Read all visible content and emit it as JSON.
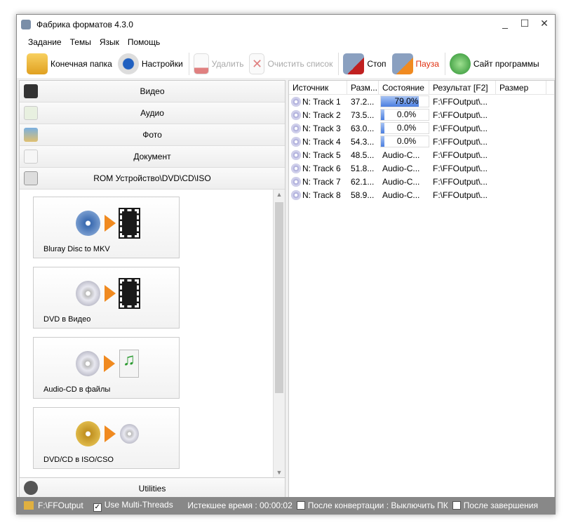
{
  "window": {
    "title": "Фабрика форматов 4.3.0",
    "minimize": "_",
    "maximize": "☐",
    "close": "✕"
  },
  "menu": [
    "Задание",
    "Темы",
    "Язык",
    "Помощь"
  ],
  "toolbar": {
    "output_folder": "Конечная папка",
    "settings": "Настройки",
    "delete": "Удалить",
    "clear_list": "Очистить список",
    "stop": "Стоп",
    "pause": "Пауза",
    "website": "Сайт программы"
  },
  "categories": [
    "Видео",
    "Аудио",
    "Фото",
    "Документ",
    "ROM Устройство\\DVD\\CD\\ISO"
  ],
  "cards": [
    "Bluray Disc to MKV",
    "DVD в Видео",
    "Audio-CD в файлы",
    "DVD/CD в ISO/CSO"
  ],
  "utilities": "Utilities",
  "table": {
    "headers": [
      "Источник",
      "Разм...",
      "Состояние",
      "Результат [F2]",
      "Размер"
    ],
    "rows": [
      {
        "source": "N: Track 1",
        "size": "37.2...",
        "state": "79.0%",
        "progress": 79,
        "result": "F:\\FFOutput\\..."
      },
      {
        "source": "N: Track 2",
        "size": "73.5...",
        "state": "0.0%",
        "progress": 0,
        "result": "F:\\FFOutput\\..."
      },
      {
        "source": "N: Track 3",
        "size": "63.0...",
        "state": "0.0%",
        "progress": 0,
        "result": "F:\\FFOutput\\..."
      },
      {
        "source": "N: Track 4",
        "size": "54.3...",
        "state": "0.0%",
        "progress": 0,
        "result": "F:\\FFOutput\\..."
      },
      {
        "source": "N: Track 5",
        "size": "48.5...",
        "state": "Audio-C...",
        "result": "F:\\FFOutput\\..."
      },
      {
        "source": "N: Track 6",
        "size": "51.8...",
        "state": "Audio-C...",
        "result": "F:\\FFOutput\\..."
      },
      {
        "source": "N: Track 7",
        "size": "62.1...",
        "state": "Audio-C...",
        "result": "F:\\FFOutput\\..."
      },
      {
        "source": "N: Track 8",
        "size": "58.9...",
        "state": "Audio-C...",
        "result": "F:\\FFOutput\\..."
      }
    ]
  },
  "status": {
    "folder": "F:\\FFOutput",
    "multithreads": "Use Multi-Threads",
    "multithreads_checked": true,
    "elapsed": "Истекшее время : 00:00:02",
    "after_convert": "После конвертации : Выключить ПК",
    "after_convert_checked": false,
    "after_finish": "После завершения",
    "after_finish_checked": false
  },
  "colors": {
    "pause_text": "#e03010",
    "progress": "#4a7ee0",
    "statusbar": "#888888"
  }
}
